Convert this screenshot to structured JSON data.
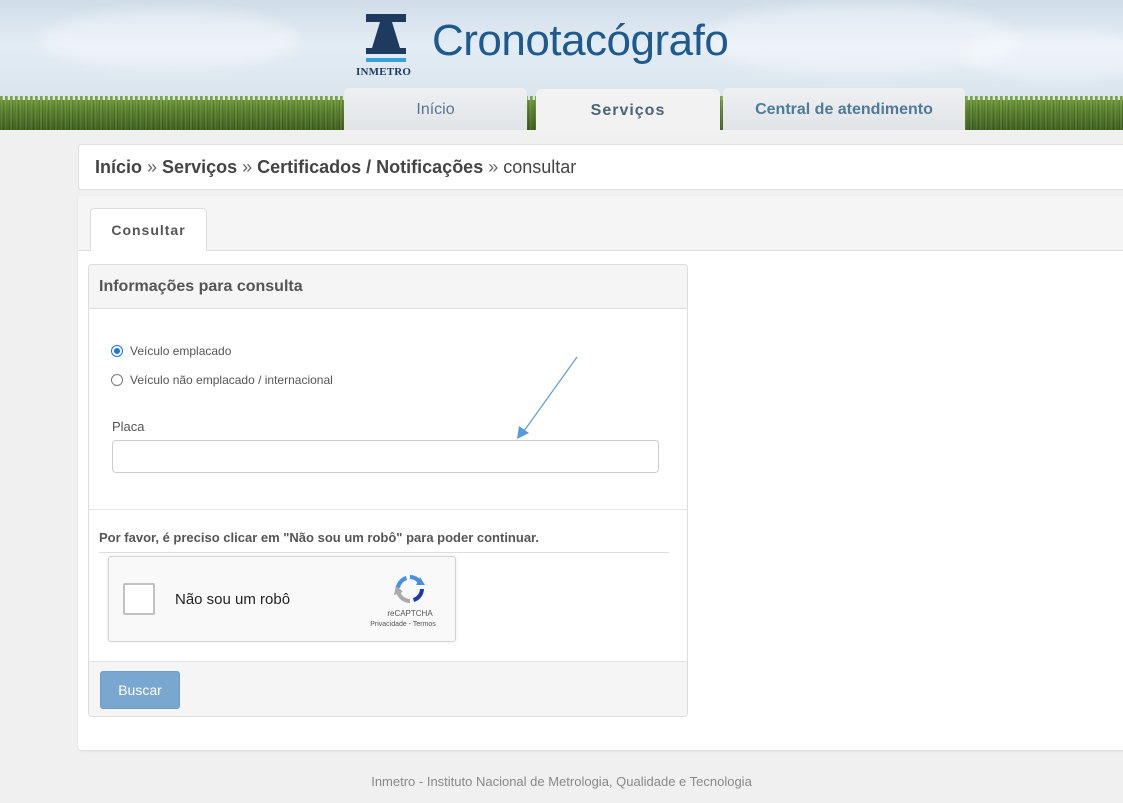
{
  "header": {
    "logo_text": "INMETRO",
    "site_title": "Cronotacógrafo",
    "tabs": [
      {
        "label": "Início",
        "active": false
      },
      {
        "label": "Serviços",
        "active": true
      },
      {
        "label": "Central de atendimento",
        "active": false
      }
    ]
  },
  "breadcrumb": {
    "items": [
      "Início",
      "Serviços",
      "Certificados / Notificações"
    ],
    "separator": "»",
    "current": "consultar"
  },
  "main": {
    "tab_label": "Consultar",
    "panel_title": "Informações para consulta",
    "radios": [
      {
        "label": "Veículo emplacado",
        "checked": true
      },
      {
        "label": "Veículo não emplacado / internacional",
        "checked": false
      }
    ],
    "placa_label": "Placa",
    "placa_value": "",
    "captcha_message": "Por favor, é preciso clicar em \"Não sou um robô\" para poder continuar.",
    "recaptcha": {
      "label": "Não sou um robô",
      "brand": "reCAPTCHA",
      "links": "Privacidade - Termos"
    },
    "search_button": "Buscar"
  },
  "footer": {
    "text": "Inmetro - Instituto Nacional de Metrologia, Qualidade e Tecnologia"
  },
  "colors": {
    "title_blue": "#1f5a8f",
    "button_blue": "#7aa7cf",
    "radio_blue": "#1a73e8",
    "arrow_blue": "#5b9bd5"
  }
}
